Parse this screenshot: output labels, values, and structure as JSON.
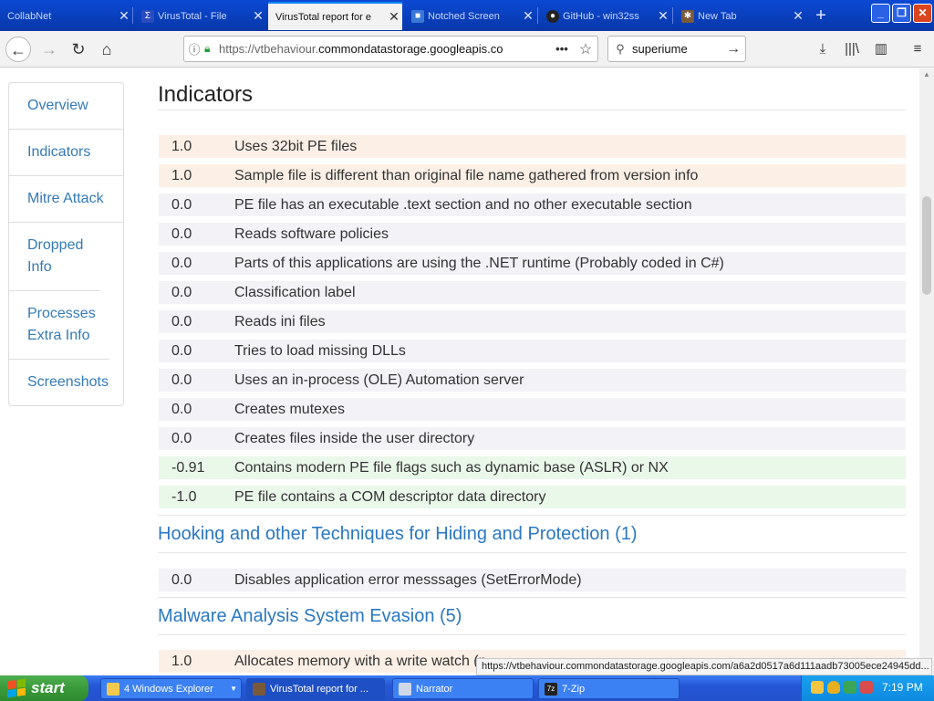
{
  "browser": {
    "tabs": [
      {
        "label": "CollabNet",
        "active": false
      },
      {
        "label": "VirusTotal - File",
        "active": false
      },
      {
        "label": "VirusTotal report for e",
        "active": true
      },
      {
        "label": "Notched Screen",
        "active": false
      },
      {
        "label": "GitHub - win32ss",
        "active": false
      },
      {
        "label": "New Tab",
        "active": false
      }
    ],
    "url_prefix": "https://vtbehaviour.",
    "url_domain": "commondatastorage.googleapis.co",
    "search_value": "superiume",
    "status_url": "https://vtbehaviour.commondatastorage.googleapis.com/a6a2d0517a6d111aadb73005ece24945dd..."
  },
  "sidebar": {
    "items": [
      {
        "label": "Overview"
      },
      {
        "label": "Indicators"
      },
      {
        "label": "Mitre Attack"
      },
      {
        "label": "Dropped Info"
      },
      {
        "label": "Processes Extra Info"
      },
      {
        "label": "Screenshots"
      }
    ]
  },
  "page": {
    "title": "Indicators",
    "indicators": [
      {
        "score": "1.0",
        "text": "Uses 32bit PE files",
        "kind": "pos"
      },
      {
        "score": "1.0",
        "text": "Sample file is different than original file name gathered from version info",
        "kind": "pos"
      },
      {
        "score": "0.0",
        "text": "PE file has an executable .text section and no other executable section",
        "kind": "neu"
      },
      {
        "score": "0.0",
        "text": "Reads software policies",
        "kind": "neu"
      },
      {
        "score": "0.0",
        "text": "Parts of this applications are using the .NET runtime (Probably coded in C#)",
        "kind": "neu"
      },
      {
        "score": "0.0",
        "text": "Classification label",
        "kind": "neu"
      },
      {
        "score": "0.0",
        "text": "Reads ini files",
        "kind": "neu"
      },
      {
        "score": "0.0",
        "text": "Tries to load missing DLLs",
        "kind": "neu"
      },
      {
        "score": "0.0",
        "text": "Uses an in-process (OLE) Automation server",
        "kind": "neu"
      },
      {
        "score": "0.0",
        "text": "Creates mutexes",
        "kind": "neu"
      },
      {
        "score": "0.0",
        "text": "Creates files inside the user directory",
        "kind": "neu"
      },
      {
        "score": "-0.91",
        "text": "Contains modern PE file flags such as dynamic base (ASLR) or NX",
        "kind": "neg"
      },
      {
        "score": "-1.0",
        "text": "PE file contains a COM descriptor data directory",
        "kind": "neg"
      }
    ],
    "section_hooking": {
      "title": "Hooking and other Techniques for Hiding and Protection (1)",
      "rows": [
        {
          "score": "0.0",
          "text": "Disables application error messsages (SetErrorMode)",
          "kind": "neu"
        }
      ]
    },
    "section_evasion": {
      "title": "Malware Analysis System Evasion (5)",
      "rows": [
        {
          "score": "1.0",
          "text": "Allocates memory with a write watch (p",
          "kind": "pos"
        }
      ]
    }
  },
  "taskbar": {
    "start_label": "start",
    "items": [
      {
        "label": "4 Windows Explorer"
      },
      {
        "label": "VirusTotal report for ..."
      },
      {
        "label": "Narrator"
      },
      {
        "label": "7-Zip"
      }
    ],
    "clock": "7:19 PM"
  },
  "colors": {
    "link": "#337ab7",
    "positive_row": "#fcefe6",
    "neutral_row": "#f2f2f7",
    "negative_row": "#eaf8ea",
    "xp_taskbar": "#2456d6",
    "xp_start": "#3a9a3a"
  }
}
